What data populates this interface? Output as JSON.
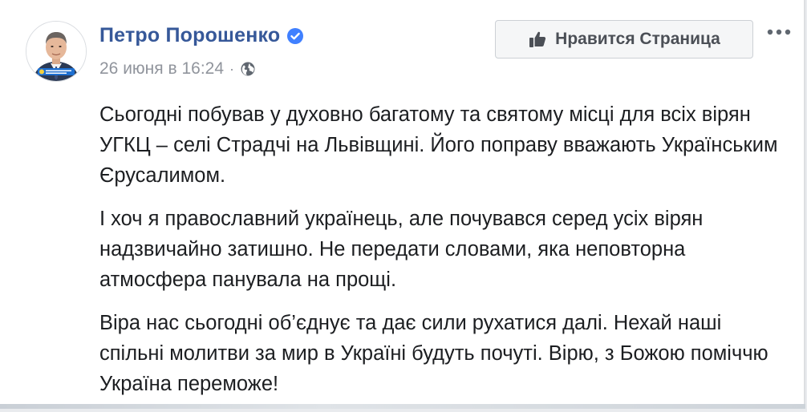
{
  "post": {
    "author": "Петро Порошенко",
    "date": "26 июня в 16:24",
    "separator": "·",
    "paragraphs": [
      "Сьогодні побував у духовно багатому та святому місці для всіх вірян УГКЦ – селі Страдчі на Львівщині. Його поправу вважають Українським Єрусалимом.",
      "І хоч я православний українець, але почувався серед усіх вірян надзвичайно затишно. Не передати словами, яка неповторна атмосфера панувала на прощі.",
      "Віра нас сьогодні об’єднує та дає сили рухатися далі. Нехай наші спільні молитви за мир в Україні будуть почуті. Вірю, з Божою поміччю Україна переможе!"
    ]
  },
  "actions": {
    "like_page_label": "Нравится Страница"
  },
  "icons": {
    "verified": "verified-badge-icon",
    "audience": "globe-icon",
    "like": "thumbs-up-icon",
    "more": "more-options-icon"
  },
  "colors": {
    "author_link": "#365899",
    "verified_badge": "#4080ff",
    "meta_text": "#90949c",
    "body_text": "#1c1e21",
    "button_bg": "#f5f6f7"
  }
}
